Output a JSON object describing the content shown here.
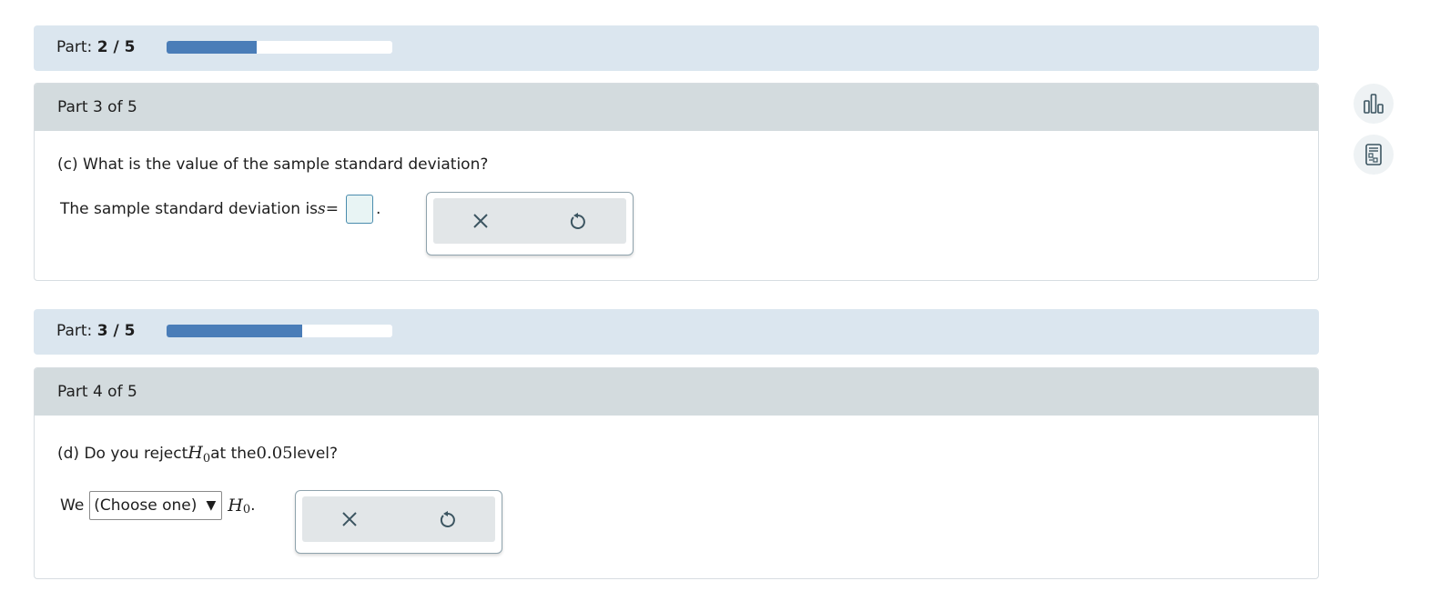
{
  "progress_1": {
    "label_prefix": "Part: ",
    "label_value": "2 / 5",
    "fraction": 0.4
  },
  "part_c": {
    "header": "Part 3 of 5",
    "question": "(c) What is the value of the sample standard deviation?",
    "answer_prefix": "The sample standard deviation is ",
    "math_var": "s",
    "equals": " =",
    "period": "."
  },
  "progress_2": {
    "label_prefix": "Part: ",
    "label_value": "3 / 5",
    "fraction": 0.6
  },
  "part_d": {
    "header": "Part 4 of 5",
    "question_start": "(d) Do you reject ",
    "math_h": "H",
    "math_sub": "0",
    "question_mid": " at the ",
    "math_level": "0.05",
    "question_end": " level?",
    "answer_prefix": "We",
    "select_value": "(Choose one)",
    "select_arrow": "▼",
    "period": "."
  },
  "tools": {
    "clear_glyph": "×",
    "undo_glyph": "↺"
  },
  "icons": {
    "side_1": "bar-chart-icon",
    "side_2": "calculator-icon"
  },
  "colors": {
    "accent": "#4a7db8",
    "progress_bg": "#dbe6ef",
    "header_bg": "#d3dbde"
  }
}
